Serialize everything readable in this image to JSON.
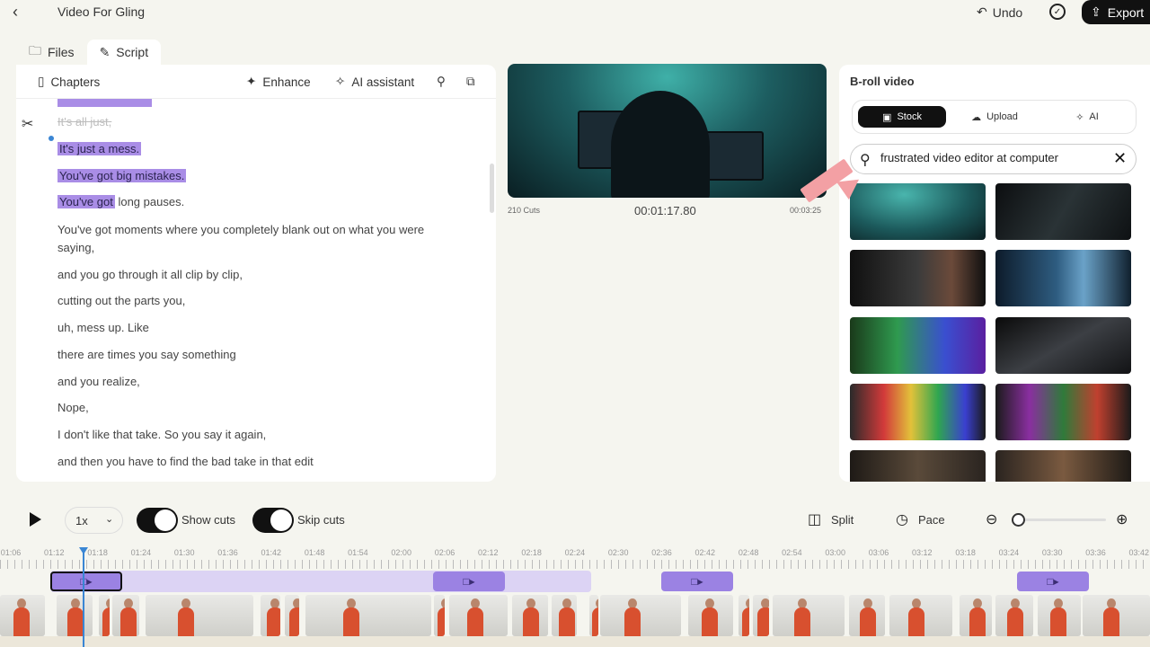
{
  "header": {
    "title": "Video For Gling",
    "undo_label": "Undo",
    "export_label": "Export"
  },
  "tabs": [
    {
      "label": "Files"
    },
    {
      "label": "Script",
      "active": true
    }
  ],
  "script_toolbar": {
    "chapters_label": "Chapters",
    "enhance_label": "Enhance",
    "ai_assistant_label": "AI assistant"
  },
  "script_lines": [
    {
      "text": "It's all just,",
      "state": "cut"
    },
    {
      "text": "It's just a mess.",
      "state": "highlighted"
    },
    {
      "text": "You've got big mistakes.",
      "state": "highlighted"
    },
    {
      "highlight": "You've got",
      "rest": " long pauses.",
      "state": "partial"
    },
    {
      "text": "You've got moments where you completely blank out on what you were",
      "state": "normal"
    },
    {
      "text": "saying,",
      "state": "normal"
    },
    {
      "text": "and you go through it all clip by clip,",
      "state": "normal"
    },
    {
      "text": "cutting out the parts you,",
      "state": "normal"
    },
    {
      "text": "uh, mess up. Like",
      "state": "normal"
    },
    {
      "text": "there are times you say something",
      "state": "normal"
    },
    {
      "text": "and you realize,",
      "state": "normal"
    },
    {
      "text": "Nope,",
      "state": "normal"
    },
    {
      "text": "I don't like that take. So you say it again,",
      "state": "normal"
    },
    {
      "text": "and then you have to find the bad take in that edit",
      "state": "normal"
    }
  ],
  "preview": {
    "cuts": "210 Cuts",
    "timecode": "00:01:17.80",
    "duration": "00:03:25"
  },
  "broll": {
    "title": "B-roll video",
    "sources": [
      {
        "label": "Stock",
        "icon": "image-icon",
        "active": true
      },
      {
        "label": "Upload",
        "icon": "cloud-upload-icon"
      },
      {
        "label": "AI",
        "icon": "sparkle-icon"
      }
    ],
    "search_value": "frustrated video editor at computer"
  },
  "controls": {
    "speed": "1x",
    "show_cuts_label": "Show cuts",
    "skip_cuts_label": "Skip cuts",
    "split_label": "Split",
    "pace_label": "Pace",
    "zoom_level": 0.0
  },
  "ruler_ticks": [
    "01:06",
    "01:12",
    "01:18",
    "01:24",
    "01:30",
    "01:36",
    "01:42",
    "01:48",
    "01:54",
    "02:00",
    "02:06",
    "02:12",
    "02:18",
    "02:24",
    "02:30",
    "02:36",
    "02:42",
    "02:48",
    "02:54",
    "03:00",
    "03:06",
    "03:12",
    "03:18",
    "03:24",
    "03:30",
    "03:36",
    "03:42"
  ],
  "colors": {
    "accent_purple": "#9b82e3",
    "highlight": "#a98de6",
    "playhead": "#3a86d4",
    "dark": "#111111"
  }
}
